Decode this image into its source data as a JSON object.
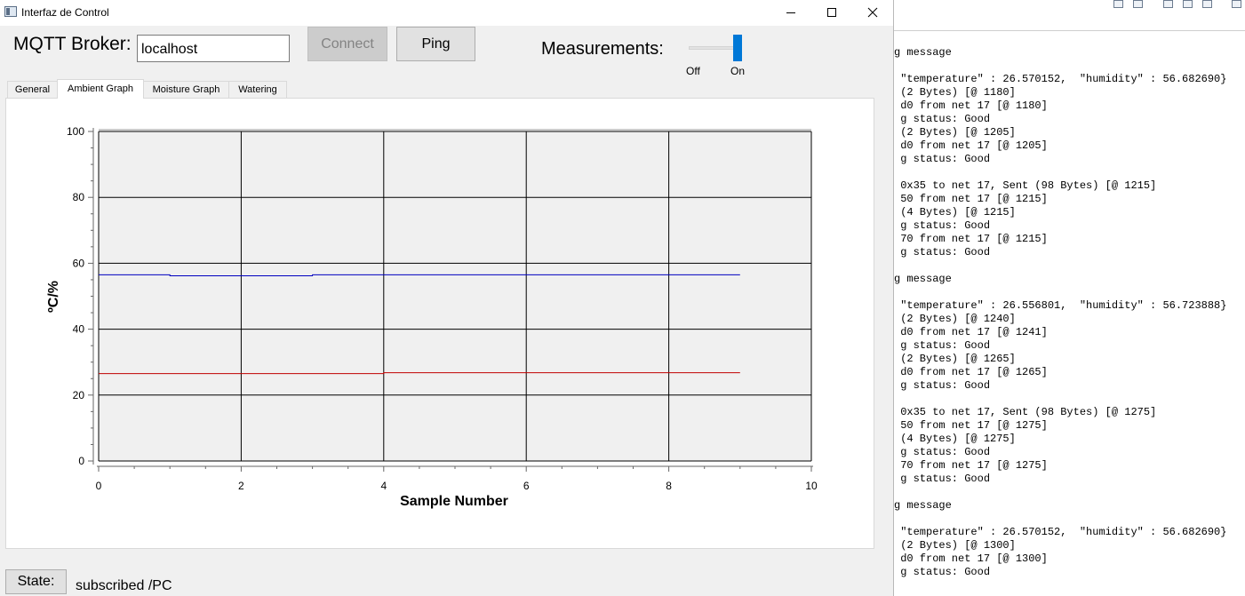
{
  "window": {
    "title": "Interfaz de Control",
    "controls": [
      "minimize-icon",
      "maximize-icon",
      "close-icon"
    ]
  },
  "header": {
    "broker_label": "MQTT Broker:",
    "broker_value": "localhost",
    "connect_label": "Connect",
    "ping_label": "Ping",
    "measurements_label": "Measurements:",
    "toggle_off_label": "Off",
    "toggle_on_label": "On",
    "toggle_state": "On"
  },
  "tabs": [
    {
      "label": "General"
    },
    {
      "label": "Ambient Graph"
    },
    {
      "label": "Moisture Graph"
    },
    {
      "label": "Watering"
    }
  ],
  "active_tab": "Ambient Graph",
  "chart_data": {
    "type": "line",
    "title": "",
    "xlabel": "Sample Number",
    "ylabel": "ºC/%",
    "xlim": [
      0,
      10
    ],
    "ylim": [
      0,
      100
    ],
    "xticks": [
      0,
      2,
      4,
      6,
      8,
      10
    ],
    "yticks": [
      0,
      20,
      40,
      60,
      80,
      100
    ],
    "grid": true,
    "background": "#f0f0f0",
    "series": [
      {
        "color": "#0000c0",
        "x": [
          0,
          1,
          2,
          3,
          4,
          5,
          6,
          7,
          8,
          9
        ],
        "values": [
          56.5,
          56.2,
          56.2,
          56.5,
          56.5,
          56.5,
          56.5,
          56.5,
          56.5,
          56.5
        ]
      },
      {
        "color": "#c00000",
        "x": [
          0,
          1,
          2,
          3,
          4,
          5,
          6,
          7,
          8,
          9
        ],
        "values": [
          26.5,
          26.5,
          26.5,
          26.5,
          26.8,
          26.8,
          26.8,
          26.8,
          26.8,
          26.8
        ]
      }
    ]
  },
  "status": {
    "button_label": "State:",
    "text": "subscribed /PC"
  },
  "console": {
    "lines": [
      "g message",
      "",
      " \"temperature\" : 26.570152,  \"humidity\" : 56.682690}",
      " (2 Bytes) [@ 1180]",
      " d0 from net 17 [@ 1180]",
      " g status: Good",
      " (2 Bytes) [@ 1205]",
      " d0 from net 17 [@ 1205]",
      " g status: Good",
      "",
      " 0x35 to net 17, Sent (98 Bytes) [@ 1215]",
      " 50 from net 17 [@ 1215]",
      " (4 Bytes) [@ 1215]",
      " g status: Good",
      " 70 from net 17 [@ 1215]",
      " g status: Good",
      "",
      "g message",
      "",
      " \"temperature\" : 26.556801,  \"humidity\" : 56.723888}",
      " (2 Bytes) [@ 1240]",
      " d0 from net 17 [@ 1241]",
      " g status: Good",
      " (2 Bytes) [@ 1265]",
      " d0 from net 17 [@ 1265]",
      " g status: Good",
      "",
      " 0x35 to net 17, Sent (98 Bytes) [@ 1275]",
      " 50 from net 17 [@ 1275]",
      " (4 Bytes) [@ 1275]",
      " g status: Good",
      " 70 from net 17 [@ 1275]",
      " g status: Good",
      "",
      "g message",
      "",
      " \"temperature\" : 26.570152,  \"humidity\" : 56.682690}",
      " (2 Bytes) [@ 1300]",
      " d0 from net 17 [@ 1300]",
      " g status: Good"
    ]
  }
}
